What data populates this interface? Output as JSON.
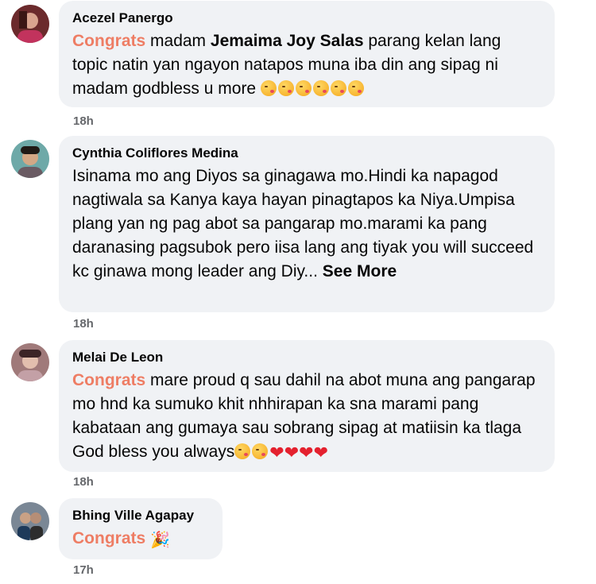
{
  "comments": [
    {
      "author": "Acezel Panergo",
      "highlight": "Congrats",
      "pre": " madam ",
      "tag": "Jemaima Joy Salas",
      "post": " parang kelan lang topic natin yan ngayon natapos muna iba din ang sipag ni madam godbless u more ",
      "emoji": "kiss-face x6",
      "time": "18h"
    },
    {
      "author": "Cynthia Coliflores Medina",
      "text": "Isinama mo ang Diyos sa ginagawa mo.Hindi ka napagod nagtiwala sa Kanya kaya hayan pinagtapos ka Niya.Umpisa plang yan ng pag abot sa pangarap mo.marami ka pang daranasing pagsubok pero iisa lang ang tiyak you will succeed kc ginawa mong leader ang Diy...",
      "see_more": "See More",
      "time": "18h"
    },
    {
      "author": "Melai De Leon",
      "highlight": "Congrats",
      "text": " mare proud q sau dahil na abot muna ang pangarap mo hnd ka sumuko khit nhhirapan ka sna marami pang kabataan ang gumaya sau sobrang sipag at matiisin ka tlaga God bless you always",
      "emoji": "kiss-face x2, red-heart x4",
      "time": "18h"
    },
    {
      "author": "Bhing Ville Agapay",
      "highlight": "Congrats",
      "emoji": "party-popper",
      "time": "17h"
    }
  ],
  "colors": {
    "highlight": "#ee7d64",
    "bubble": "#f0f2f5",
    "meta": "#65676b"
  }
}
